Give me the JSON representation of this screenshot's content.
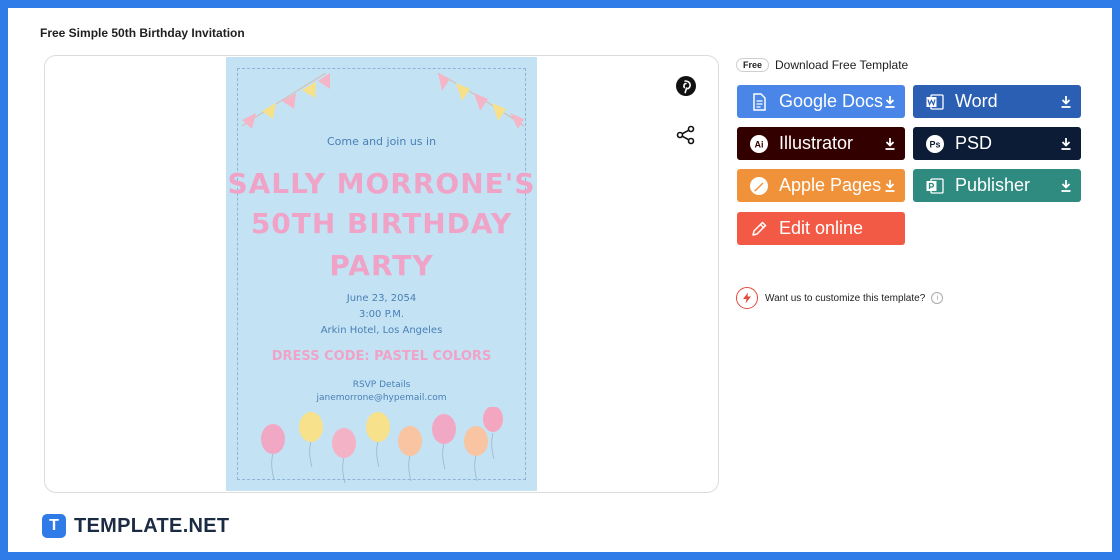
{
  "page": {
    "title": "Free Simple 50th Birthday Invitation"
  },
  "invitation": {
    "intro": "Come and join us in",
    "name_line1": "SALLY MORRONE'S",
    "name_line2": "50TH BIRTHDAY",
    "name_line3": "PARTY",
    "date": "June 23, 2054",
    "time": "3:00 P.M.",
    "venue": "Arkin Hotel, Los Angeles",
    "dress_code": "DRESS CODE: PASTEL COLORS",
    "rsvp_label": "RSVP Details",
    "rsvp_email": "janemorrone@hypemail.com",
    "colors": {
      "background": "#c3e3f5",
      "pink": "#efa3c7",
      "blue": "#4a7fb5"
    }
  },
  "share": {
    "pinterest_icon": "pinterest-icon",
    "share_icon": "share-icon"
  },
  "download": {
    "badge": "Free",
    "heading": "Download Free Template",
    "buttons": [
      {
        "label": "Google Docs",
        "icon": "google-docs-icon",
        "color": "#4a86e8"
      },
      {
        "label": "Word",
        "icon": "word-icon",
        "color": "#2b5fb4"
      },
      {
        "label": "Illustrator",
        "icon": "illustrator-icon",
        "color": "#330000"
      },
      {
        "label": "PSD",
        "icon": "psd-icon",
        "color": "#0d1c36"
      },
      {
        "label": "Apple Pages",
        "icon": "apple-pages-icon",
        "color": "#f0923a"
      },
      {
        "label": "Publisher",
        "icon": "publisher-icon",
        "color": "#2f8a7f"
      },
      {
        "label": "Edit online",
        "icon": "pencil-icon",
        "color": "#f25a46"
      }
    ]
  },
  "customize": {
    "text": "Want us to customize this template?"
  },
  "brand": {
    "logo_letter": "T",
    "name": "TEMPLATE.NET"
  }
}
